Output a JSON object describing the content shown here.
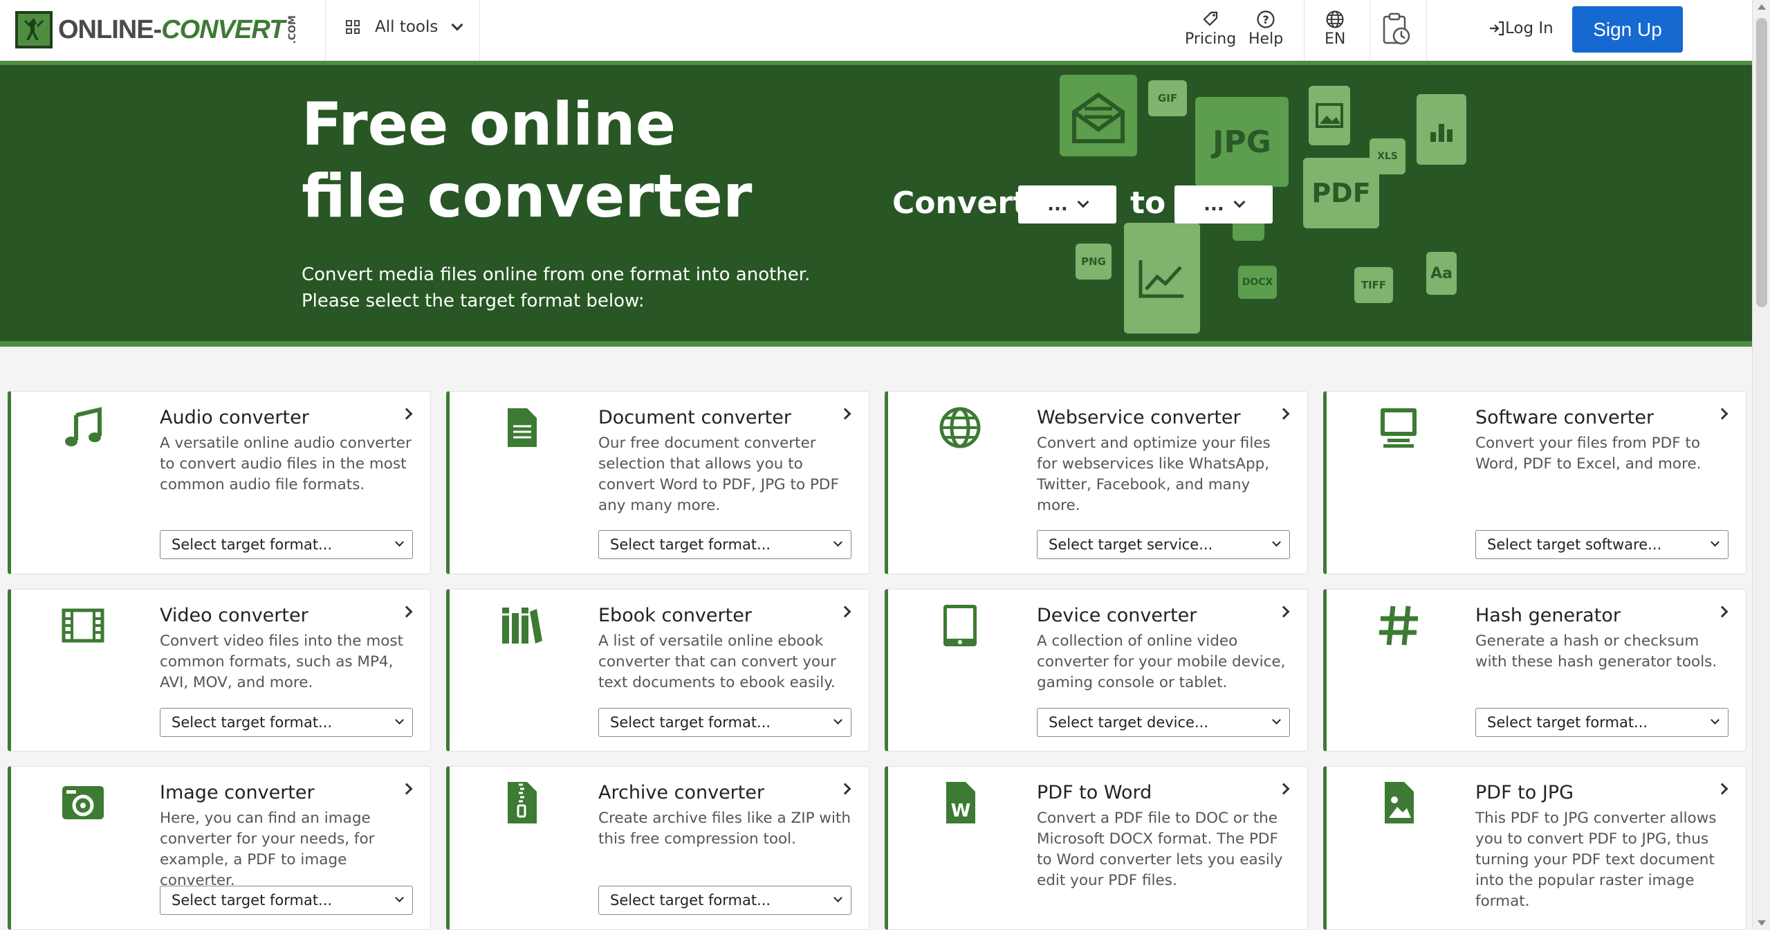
{
  "header": {
    "logo_main": "ONLINE-",
    "logo_accent": "CONVERT",
    "logo_com": ".COM",
    "all_tools_label": "All tools",
    "pricing_label": "Pricing",
    "help_label": "Help",
    "language_label": "EN",
    "login_label": "Log In",
    "signup_label": "Sign Up"
  },
  "hero": {
    "title": "Free online file converter",
    "subtitle": "Convert media files online from one format into another. Please select the target format below:",
    "convert_label": "Convert",
    "to_label": "to",
    "from_select": "...",
    "to_select": "...",
    "file_icons": [
      "GIF",
      "JPG",
      "XLS",
      "PDF",
      "PNG",
      "DOCX",
      "TIFF",
      "Aa"
    ]
  },
  "colors": {
    "brand_green": "#285725",
    "accent_green": "#3d7a33",
    "signup_blue": "#1769d2"
  },
  "cards": [
    {
      "title": "Audio converter",
      "desc": "A versatile online audio converter to convert audio files in the most common audio file formats.",
      "select": "Select target format...",
      "icon": "music-note-icon"
    },
    {
      "title": "Document converter",
      "desc": "Our free document converter selection that allows you to convert Word to PDF, JPG to PDF any many more.",
      "select": "Select target format...",
      "icon": "document-icon"
    },
    {
      "title": "Webservice converter",
      "desc": "Convert and optimize your files for webservices like WhatsApp, Twitter, Facebook, and many more.",
      "select": "Select target service...",
      "icon": "globe-icon"
    },
    {
      "title": "Software converter",
      "desc": "Convert your files from PDF to Word, PDF to Excel, and more.",
      "select": "Select target software...",
      "icon": "computer-icon"
    },
    {
      "title": "Video converter",
      "desc": "Convert video files into the most common formats, such as MP4, AVI, MOV, and more.",
      "select": "Select target format...",
      "icon": "film-icon"
    },
    {
      "title": "Ebook converter",
      "desc": "A list of versatile online ebook converter that can convert your text documents to ebook easily.",
      "select": "Select target format...",
      "icon": "books-icon"
    },
    {
      "title": "Device converter",
      "desc": "A collection of online video converter for your mobile device, gaming console or tablet.",
      "select": "Select target device...",
      "icon": "tablet-icon"
    },
    {
      "title": "Hash generator",
      "desc": "Generate a hash or checksum with these hash generator tools.",
      "select": "Select target format...",
      "icon": "hash-icon"
    },
    {
      "title": "Image converter",
      "desc": "Here, you can find an image converter for your needs, for example, a PDF to image converter.",
      "select": "Select target format...",
      "icon": "camera-icon"
    },
    {
      "title": "Archive converter",
      "desc": "Create archive files like a ZIP with this free compression tool.",
      "select": "Select target format...",
      "icon": "zip-file-icon"
    },
    {
      "title": "PDF to Word",
      "desc": "Convert a PDF file to DOC or the Microsoft DOCX format. The PDF to Word converter lets you easily edit your PDF files.",
      "select": "",
      "icon": "word-file-icon"
    },
    {
      "title": "PDF to JPG",
      "desc": "This PDF to JPG converter allows you to convert PDF to JPG, thus turning your PDF text document into the popular raster image format.",
      "select": "",
      "icon": "image-file-icon"
    }
  ]
}
